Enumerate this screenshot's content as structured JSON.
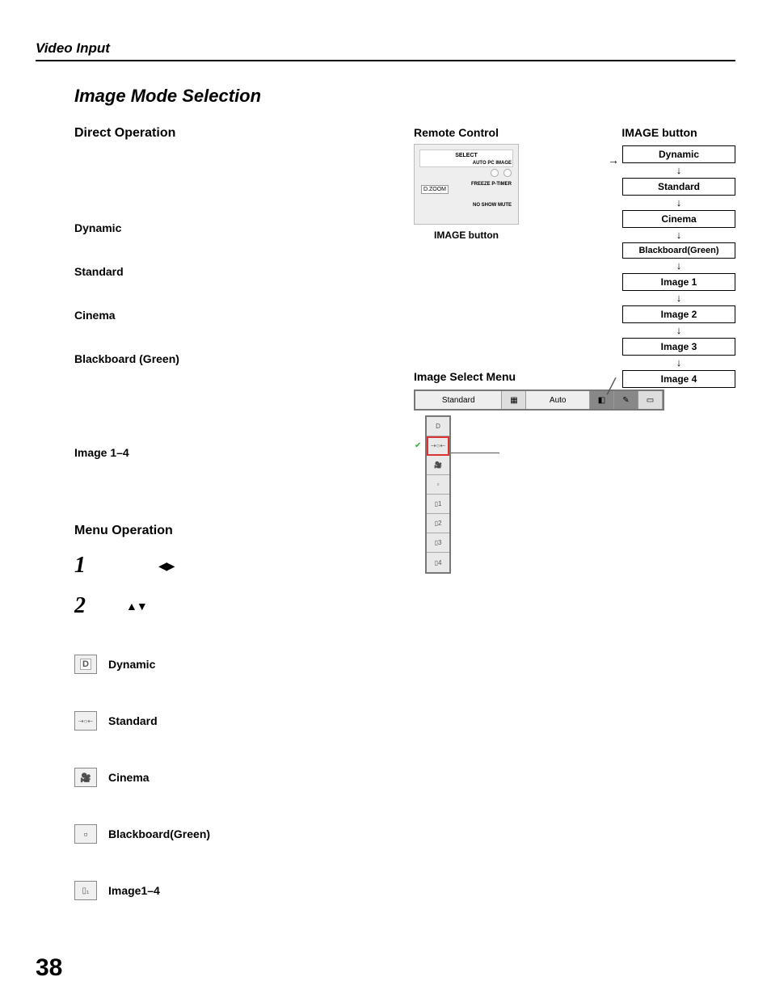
{
  "header": {
    "section": "Video Input"
  },
  "title": "Image Mode Selection",
  "direct": {
    "heading": "Direct Operation",
    "modes": {
      "dynamic": "Dynamic",
      "standard": "Standard",
      "cinema": "Cinema",
      "blackboard": "Blackboard (Green)",
      "image14": "Image 1–4"
    }
  },
  "remote": {
    "heading": "Remote Control",
    "button_heading": "IMAGE button",
    "image_button_label": "IMAGE button",
    "fig": {
      "select": "SELECT",
      "dzoom": "D.ZOOM",
      "autopc_image": "AUTO PC  IMAGE",
      "freeze_p": "FREEZE  P-TIMER",
      "noshow_mute": "NO SHOW  MUTE"
    }
  },
  "flow": {
    "items": [
      "Dynamic",
      "Standard",
      "Cinema",
      "Blackboard(Green)",
      "Image 1",
      "Image 2",
      "Image 3",
      "Image 4"
    ]
  },
  "menu": {
    "heading": "Menu Operation",
    "step1_arrows": "◀▶",
    "step2_arrows": "▲▼",
    "icons": {
      "dynamic": "Dynamic",
      "standard": "Standard",
      "cinema": "Cinema",
      "blackboard": "Blackboard(Green)",
      "image14": "Image1–4"
    }
  },
  "ism": {
    "heading": "Image Select Menu",
    "bar": {
      "mode": "Standard",
      "auto": "Auto"
    },
    "col_items": [
      "D",
      "⇢○⇠",
      "🎥",
      "▫",
      "▯1",
      "▯2",
      "▯3",
      "▯4"
    ]
  },
  "page_number": "38"
}
